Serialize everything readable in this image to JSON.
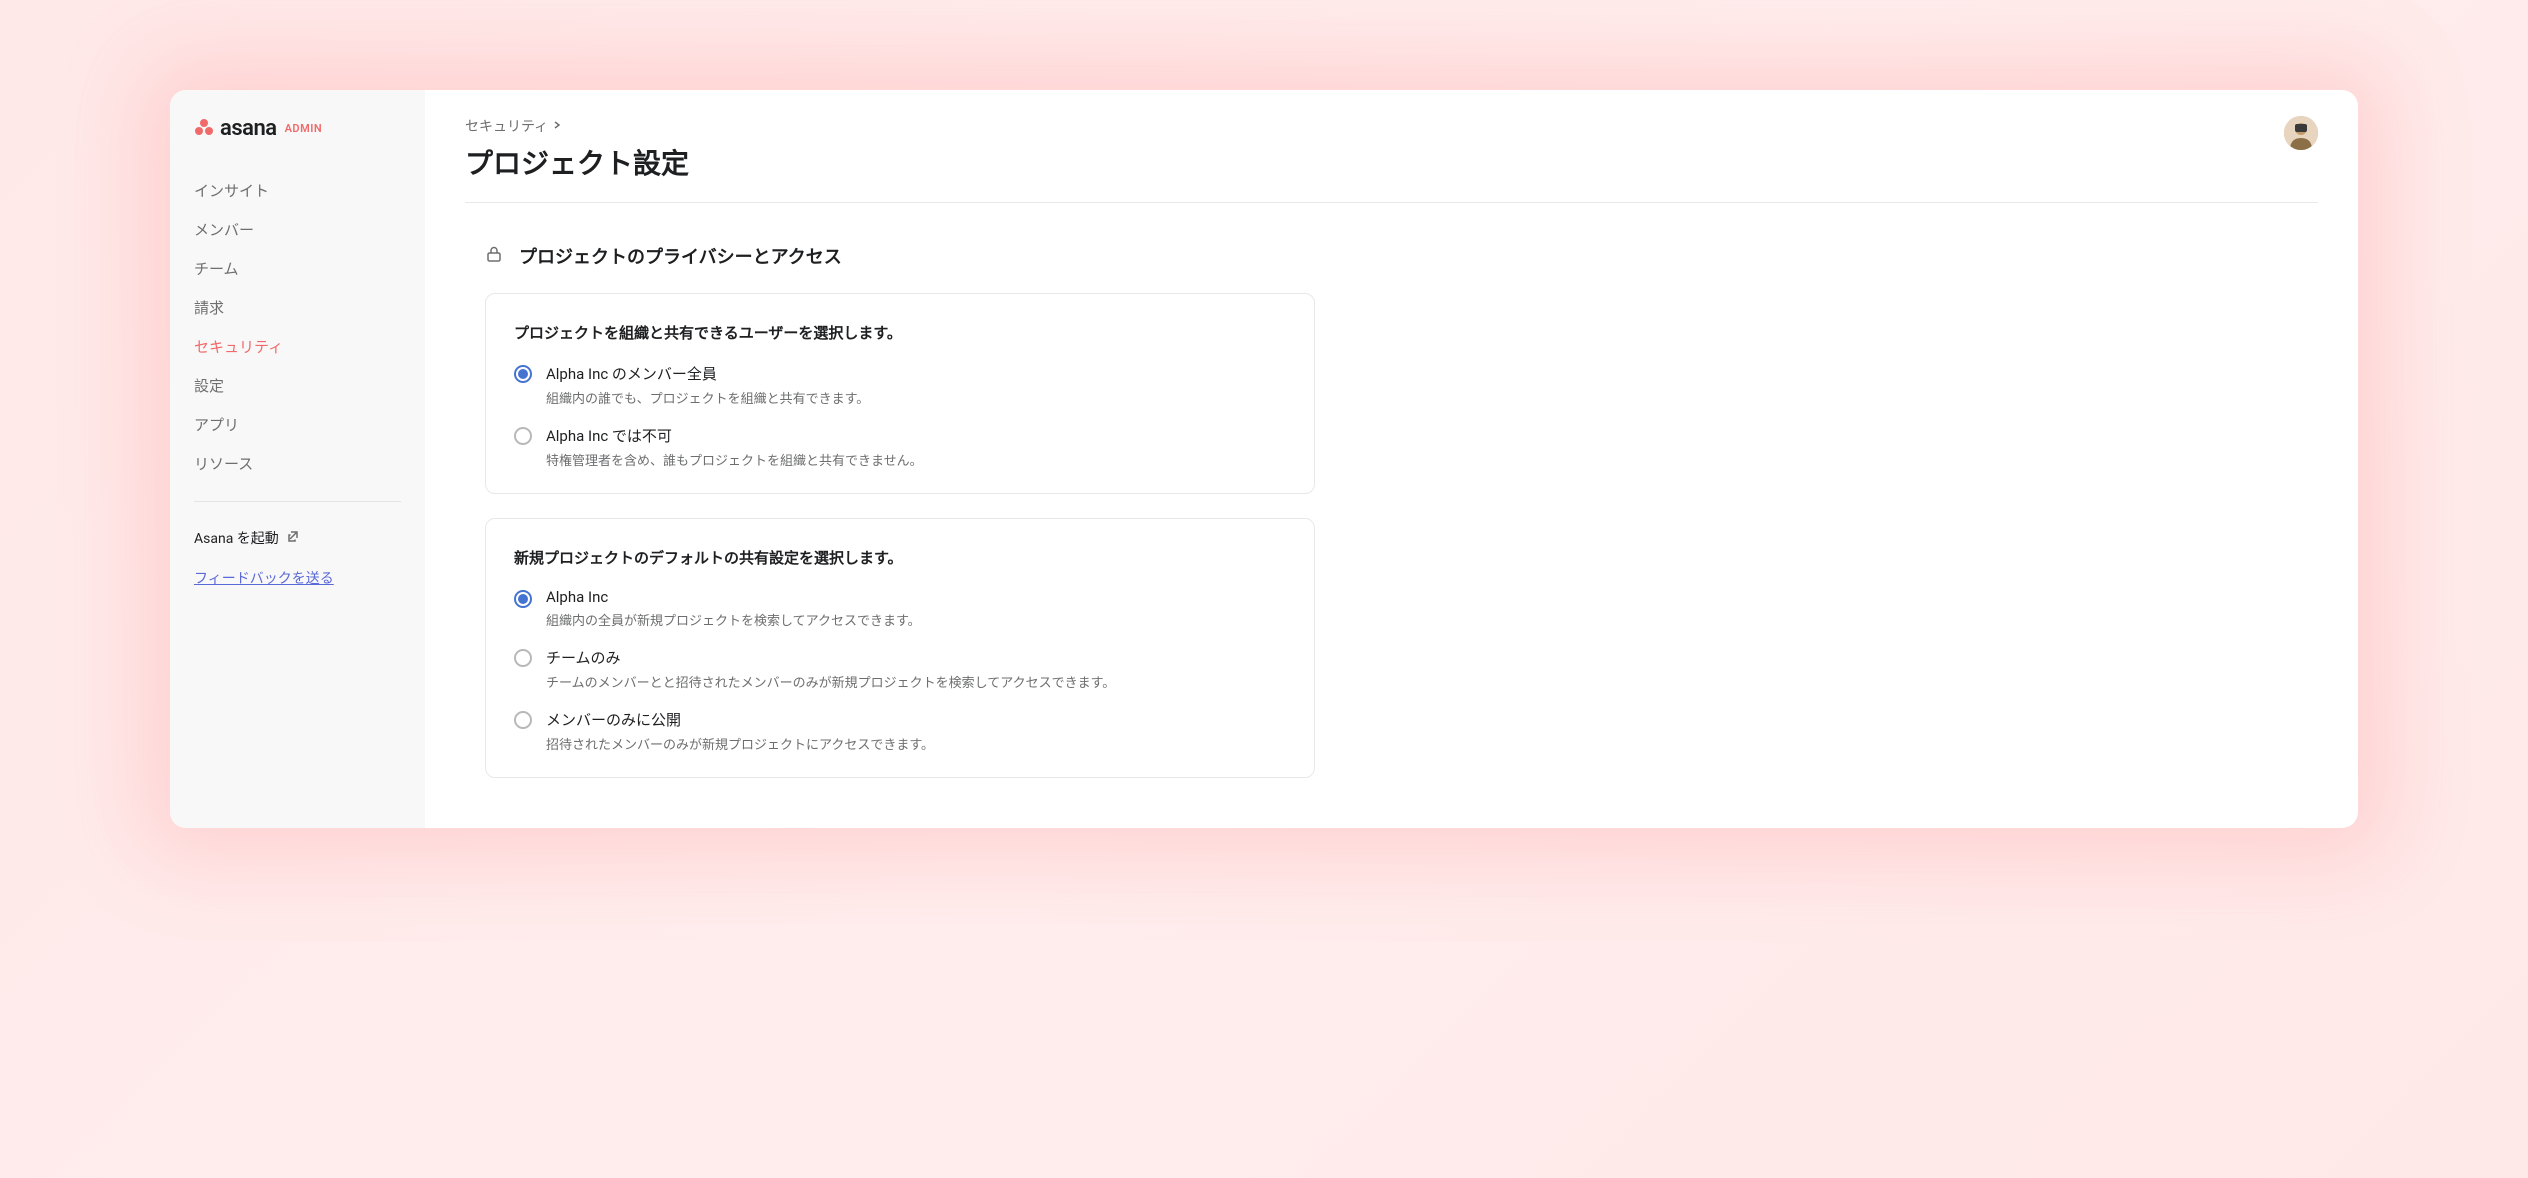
{
  "brand": {
    "name": "asana",
    "suffix": "ADMIN"
  },
  "sidebar": {
    "items": [
      {
        "label": "インサイト",
        "active": false
      },
      {
        "label": "メンバー",
        "active": false
      },
      {
        "label": "チーム",
        "active": false
      },
      {
        "label": "請求",
        "active": false
      },
      {
        "label": "セキュリティ",
        "active": true
      },
      {
        "label": "設定",
        "active": false
      },
      {
        "label": "アプリ",
        "active": false
      },
      {
        "label": "リソース",
        "active": false
      }
    ],
    "launch_label": "Asana を起動",
    "feedback_label": "フィードバックを送る"
  },
  "header": {
    "breadcrumb": "セキュリティ",
    "title": "プロジェクト設定"
  },
  "section": {
    "title": "プロジェクトのプライバシーとアクセス"
  },
  "card1": {
    "heading": "プロジェクトを組織と共有できるユーザーを選択します。",
    "options": [
      {
        "label": "Alpha Inc のメンバー全員",
        "description": "組織内の誰でも、プロジェクトを組織と共有できます。",
        "selected": true
      },
      {
        "label": "Alpha Inc では不可",
        "description": "特権管理者を含め、誰もプロジェクトを組織と共有できません。",
        "selected": false
      }
    ]
  },
  "card2": {
    "heading": "新規プロジェクトのデフォルトの共有設定を選択します。",
    "options": [
      {
        "label": "Alpha Inc",
        "description": "組織内の全員が新規プロジェクトを検索してアクセスできます。",
        "selected": true
      },
      {
        "label": "チームのみ",
        "description": "チームのメンバーとと招待されたメンバーのみが新規プロジェクトを検索してアクセスできます。",
        "selected": false
      },
      {
        "label": "メンバーのみに公開",
        "description": "招待されたメンバーのみが新規プロジェクトにアクセスできます。",
        "selected": false
      }
    ]
  }
}
